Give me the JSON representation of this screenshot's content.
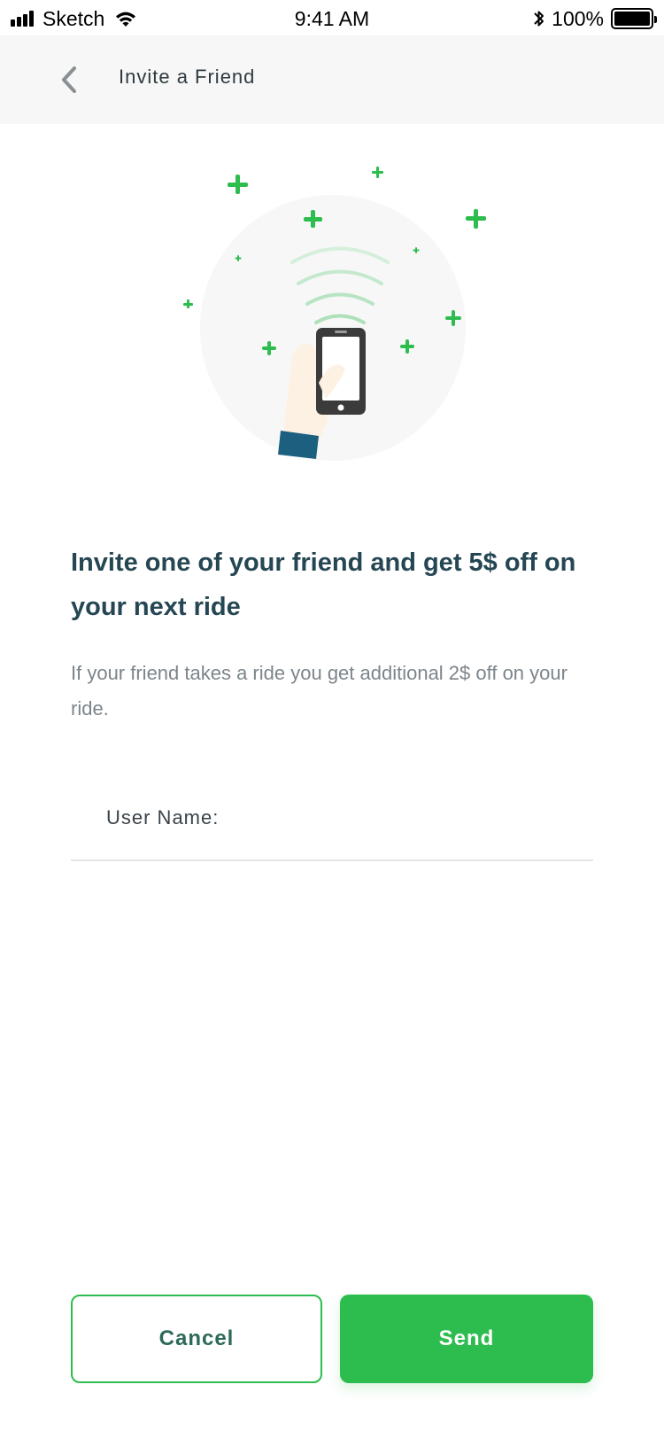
{
  "status_bar": {
    "carrier": "Sketch",
    "time": "9:41 AM",
    "battery_percent": "100%",
    "icons": [
      "signal-icon",
      "wifi-icon",
      "bluetooth-icon",
      "battery-icon"
    ]
  },
  "nav": {
    "title": "Invite a Friend",
    "back_icon": "chevron-left-icon"
  },
  "illustration": {
    "description_icons": [
      "hand-holding-phone",
      "signal-waves",
      "plus-sparkles"
    ],
    "accent_color": "#2dbd4e",
    "circle_color": "#f7f7f7"
  },
  "content": {
    "headline": "Invite one of your friend and get 5$ off on your next ride",
    "subtext": "If your friend takes a ride you get additional 2$ off on your ride."
  },
  "form": {
    "username_label": "User Name:",
    "username_value": "",
    "username_placeholder": ""
  },
  "actions": {
    "cancel_label": "Cancel",
    "send_label": "Send"
  },
  "colors": {
    "primary": "#2dbd4e",
    "heading": "#254653",
    "body_text": "#7c858b",
    "nav_bg": "#f7f7f7"
  }
}
